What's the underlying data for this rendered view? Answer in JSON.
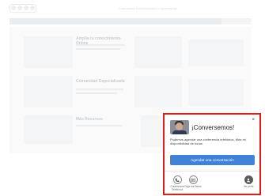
{
  "background": {
    "tagline": "Comunidad Especializada en Aprendizaje",
    "nav": [
      "",
      "",
      "",
      "",
      "",
      "",
      "",
      ""
    ],
    "blocks": [
      {
        "title": "Amplía tu conocimiento Online",
        "line1": "",
        "line2": ""
      },
      {
        "title": "Comunidad Especializada",
        "line1": "",
        "line2": ""
      },
      {
        "title": "Más Recursos",
        "line1": "",
        "line2": ""
      }
    ]
  },
  "chat": {
    "close": "×",
    "title": "¡Conversemos!",
    "text": "Podemos agendar una conferencia telefónica. Mira mi disponibilidad de horas",
    "cta_label": "Agendar una conversación",
    "actions": [
      {
        "label": "Conferencia Telefónica",
        "icon": "phone-icon"
      },
      {
        "label": "Deja tus Datos",
        "icon": "contact-card-icon"
      },
      {
        "label": "Ver perfil",
        "icon": "profile-icon"
      }
    ],
    "accent_color": "#3f82d8",
    "highlight_border": "#e21b1b"
  }
}
